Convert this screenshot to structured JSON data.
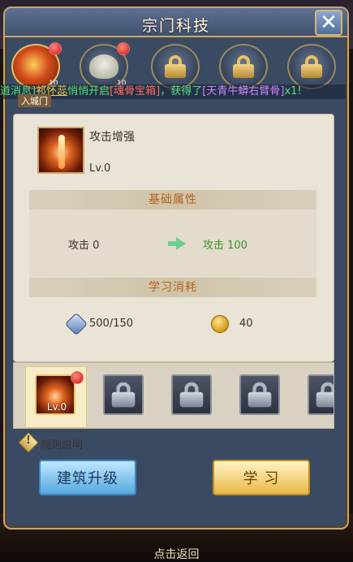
{
  "window": {
    "title": "宗门科技",
    "close_icon": "close-icon"
  },
  "tech_icons": [
    {
      "name": "attack-tech-medal",
      "state": "active",
      "badge_level": "10",
      "tab_label": "入城门"
    },
    {
      "name": "tiger-tech-medal",
      "state": "unlocked",
      "badge_level": "10"
    },
    {
      "name": "locked-tech-medal-1",
      "state": "locked"
    },
    {
      "name": "locked-tech-medal-2",
      "state": "locked"
    },
    {
      "name": "locked-tech-medal-3",
      "state": "locked"
    }
  ],
  "broadcast": {
    "prefix": "道消息]",
    "name": "祁怀蕊",
    "mid1": "悄悄开启",
    "item1": "[魂骨宝箱]",
    "mid2": "，获得了",
    "item2": "[天青牛蟒右臂骨]",
    "suffix": "x1!"
  },
  "selected_item": {
    "name": "攻击增强",
    "level": "Lv.0"
  },
  "base_attr": {
    "header": "基础属性",
    "current": "攻击 0",
    "next": "攻击 100"
  },
  "cost": {
    "header": "学习消耗",
    "gem_value": "500/150",
    "coin_value": "40"
  },
  "slots": [
    {
      "state": "selected",
      "level": "Lv.0"
    },
    {
      "state": "locked"
    },
    {
      "state": "locked"
    },
    {
      "state": "locked"
    },
    {
      "state": "locked"
    }
  ],
  "rules": {
    "label": "规则说明"
  },
  "buttons": {
    "upgrade": "建筑升级",
    "learn": "学 习"
  },
  "footer": {
    "back": "点击返回"
  },
  "colors": {
    "broadcast_green": "#51e07a",
    "highlight_yellow": "#e6d24a",
    "item_red": "#ff6a5a",
    "item_purple": "#c885ff",
    "section_orange": "#b5641d"
  }
}
